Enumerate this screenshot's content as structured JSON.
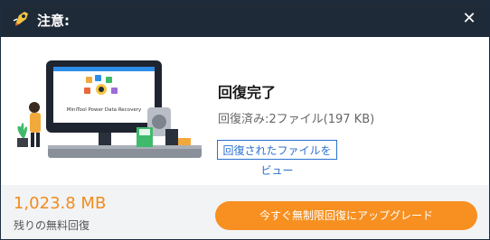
{
  "window": {
    "title": "注意:",
    "app_icon": "rocket-icon",
    "close_icon": "close-icon",
    "close_glyph": "✕"
  },
  "illustration": {
    "screen_text": "MiniTool Power Data Recovery"
  },
  "content": {
    "title": "回復完了",
    "summary": "回復済み:2ファイル(197 KB)",
    "view_button_label": "回復されたファイルをビュー"
  },
  "footer": {
    "free_remaining_value": "1,023.8 MB",
    "free_remaining_label": "残りの無料回復",
    "upgrade_button_label": "今すぐ無制限回復にアップグレード"
  },
  "colors": {
    "titlebar": "#1e2a38",
    "accent_orange": "#f79021",
    "link_blue": "#2b6fcf"
  }
}
